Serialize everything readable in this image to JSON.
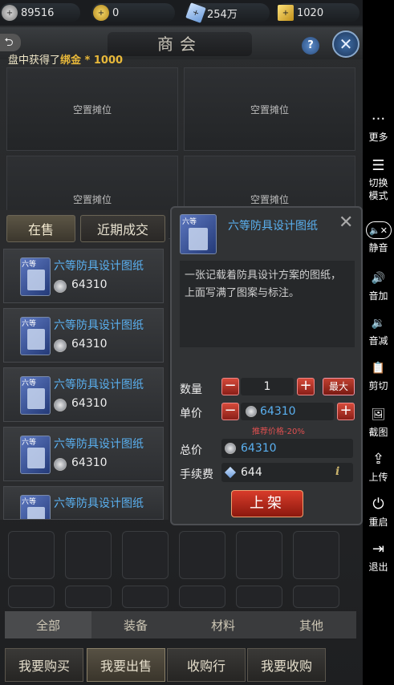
{
  "resources": [
    {
      "icon": "silver-coin-icon",
      "value": "89516"
    },
    {
      "icon": "gold-coin-icon",
      "value": "0"
    },
    {
      "icon": "diamond-icon",
      "value": "254万"
    },
    {
      "icon": "gold-ingot-icon",
      "value": "1020"
    }
  ],
  "header": {
    "title": "商会",
    "back": "⮌",
    "help": "?",
    "close": "✕"
  },
  "notice": {
    "prefix": "盘中获得了",
    "item": "绑金",
    "amount": " * 1000"
  },
  "stalls": [
    "空置摊位",
    "空置摊位",
    "空置摊位",
    "空置摊位"
  ],
  "left_tabs": [
    "在售",
    "近期成交"
  ],
  "items": [
    {
      "level": "六等",
      "name": "六等防具设计图纸",
      "price": "64310"
    },
    {
      "level": "六等",
      "name": "六等防具设计图纸",
      "price": "64310"
    },
    {
      "level": "六等",
      "name": "六等防具设计图纸",
      "price": "64310"
    },
    {
      "level": "六等",
      "name": "六等防具设计图纸",
      "price": "64310"
    },
    {
      "level": "六等",
      "name": "六等防具设计图纸",
      "price": ""
    }
  ],
  "popup": {
    "level": "六等",
    "name": "六等防具设计图纸",
    "close": "✕",
    "description": "一张记载着防具设计方案的图纸，上面写满了图案与标注。",
    "qty_label": "数量",
    "qty": "1",
    "max_label": "最大",
    "minus": "−",
    "plus": "+",
    "unit_label": "单价",
    "unit_price": "64310",
    "recommend": "推荐价格-20%",
    "total_label": "总价",
    "total": "64310",
    "fee_label": "手续费",
    "fee": "644",
    "info": "i",
    "shelf_button": "上架"
  },
  "categories": [
    "全部",
    "装备",
    "材料",
    "其他"
  ],
  "bottom_tabs": [
    "我要购买",
    "我要出售",
    "收购行",
    "我要收购"
  ],
  "sidebar": [
    {
      "icon": "more-icon",
      "glyph": "···",
      "label": "更多"
    },
    {
      "icon": "switch-mode-icon",
      "glyph": "☰",
      "label": "切换\n模式"
    },
    {
      "icon": "mute-icon",
      "glyph": "🔈✕",
      "label": "静音"
    },
    {
      "icon": "volume-up-icon",
      "glyph": "🔊",
      "label": "音加"
    },
    {
      "icon": "volume-down-icon",
      "glyph": "🔉",
      "label": "音减"
    },
    {
      "icon": "clipboard-icon",
      "glyph": "📋",
      "label": "剪切"
    },
    {
      "icon": "screenshot-icon",
      "glyph": "🖼",
      "label": "截图"
    },
    {
      "icon": "upload-icon",
      "glyph": "⇪",
      "label": "上传"
    },
    {
      "icon": "power-icon",
      "glyph": "⏻",
      "label": "重启"
    },
    {
      "icon": "exit-icon",
      "glyph": "⇥",
      "label": "退出"
    }
  ]
}
